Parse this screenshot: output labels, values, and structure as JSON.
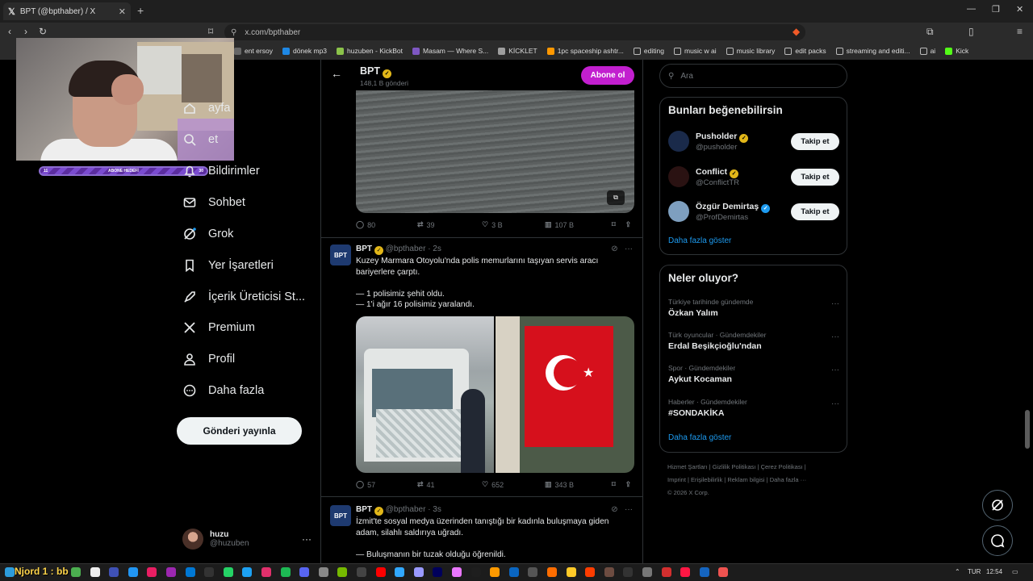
{
  "browser": {
    "tab_title": "BPT (@bpthaber) / X",
    "url": "x.com/bpthaber",
    "bookmarks": [
      {
        "label": "ent ersoy",
        "color": "#666"
      },
      {
        "label": "dönek mp3",
        "color": "#1e88e5"
      },
      {
        "label": "huzuben - KickBot",
        "color": "#8bc34a"
      },
      {
        "label": "Masam — Where S...",
        "color": "#7e57c2"
      },
      {
        "label": "KİCKLET",
        "color": "#9e9e9e"
      },
      {
        "label": "1pc spaceship ashtr...",
        "color": "#ff9800"
      },
      {
        "label": "editing",
        "color": "folder"
      },
      {
        "label": "music w ai",
        "color": "folder"
      },
      {
        "label": "music library",
        "color": "folder"
      },
      {
        "label": "edit packs",
        "color": "folder"
      },
      {
        "label": "streaming and editi...",
        "color": "folder"
      },
      {
        "label": "ai",
        "color": "folder"
      },
      {
        "label": "Kick",
        "color": "#53fc18"
      }
    ]
  },
  "overlay": {
    "sub_left": "11",
    "sub_label": "ABONE HEDEFİ",
    "sub_right": "30",
    "nlabel": "Njord 1 : bb"
  },
  "sidebar": {
    "items": [
      {
        "label": "ayfa",
        "icon": "home-icon"
      },
      {
        "label": "et",
        "icon": "explore-icon"
      },
      {
        "label": "Bildirimler",
        "icon": "bell-icon"
      },
      {
        "label": "Sohbet",
        "icon": "mail-icon"
      },
      {
        "label": "Grok",
        "icon": "grok-icon"
      },
      {
        "label": "Yer İşaretleri",
        "icon": "bookmark-icon"
      },
      {
        "label": "İçerik Üreticisi St...",
        "icon": "rocket-icon"
      },
      {
        "label": "Premium",
        "icon": "x-logo-icon"
      },
      {
        "label": "Profil",
        "icon": "person-icon"
      },
      {
        "label": "Daha fazla",
        "icon": "more-circle-icon"
      }
    ],
    "post_button": "Gönderi yayınla",
    "account": {
      "name": "huzu",
      "handle": "@huzuben",
      "more": "···"
    }
  },
  "profile_header": {
    "name": "BPT",
    "post_count": "148,1 B gönderi",
    "subscribe": "Abone ol"
  },
  "tweets": [
    {
      "replies": "80",
      "reposts": "39",
      "likes": "3 B",
      "views": "107 B"
    },
    {
      "name": "BPT",
      "handle": "@bpthaber · 2s",
      "lines": [
        "Kuzey Marmara Otoyolu'nda polis memurlarını taşıyan servis aracı",
        "bariyerlere çarptı.",
        "",
        "— 1 polisimiz şehit oldu.",
        "— 1'i ağır 16 polisimiz yaralandı."
      ],
      "replies": "57",
      "reposts": "41",
      "likes": "652",
      "views": "343 B"
    },
    {
      "name": "BPT",
      "handle": "@bpthaber · 3s",
      "lines": [
        "İzmit'te sosyal medya üzerinden tanıştığı bir kadınla buluşmaya giden",
        "adam, silahlı saldırıya uğradı.",
        "",
        "— Buluşmanın bir tuzak olduğu öğrenildi."
      ]
    }
  ],
  "right": {
    "search_placeholder": "Ara",
    "who_to_follow_title": "Bunları beğenebilirsin",
    "who": [
      {
        "name": "Pusholder",
        "handle": "@pusholder",
        "badge": "gold",
        "button": "Takip et"
      },
      {
        "name": "Conflict",
        "handle": "@ConflictTR",
        "badge": "gold",
        "button": "Takip et"
      },
      {
        "name": "Özgür Demirtaş",
        "handle": "@ProfDemirtas",
        "badge": "blue",
        "button": "Takip et"
      }
    ],
    "show_more": "Daha fazla göster",
    "trends_title": "Neler oluyor?",
    "trends": [
      {
        "context": "Türkiye tarihinde gündemde",
        "name": "Özkan Yalım"
      },
      {
        "context": "Türk oyuncular · Gündemdekiler",
        "name": "Erdal Beşikçioğlu'ndan"
      },
      {
        "context": "Spor · Gündemdekiler",
        "name": "Aykut Kocaman"
      },
      {
        "context": "Haberler · Gündemdekiler",
        "name": "#SONDAKİKA"
      }
    ],
    "trends_more": "Daha fazla göster",
    "footer_line1": "Hizmet Şartları  |  Gizlilik Politikası  |  Çerez Politikası  |",
    "footer_line2": "Imprint  |  Erişilebilirlik  |  Reklam bilgisi  |  Daha fazla ···",
    "footer_line3": "© 2026 X Corp."
  },
  "taskbar": {
    "lang": "TUR",
    "time": "12:54"
  }
}
